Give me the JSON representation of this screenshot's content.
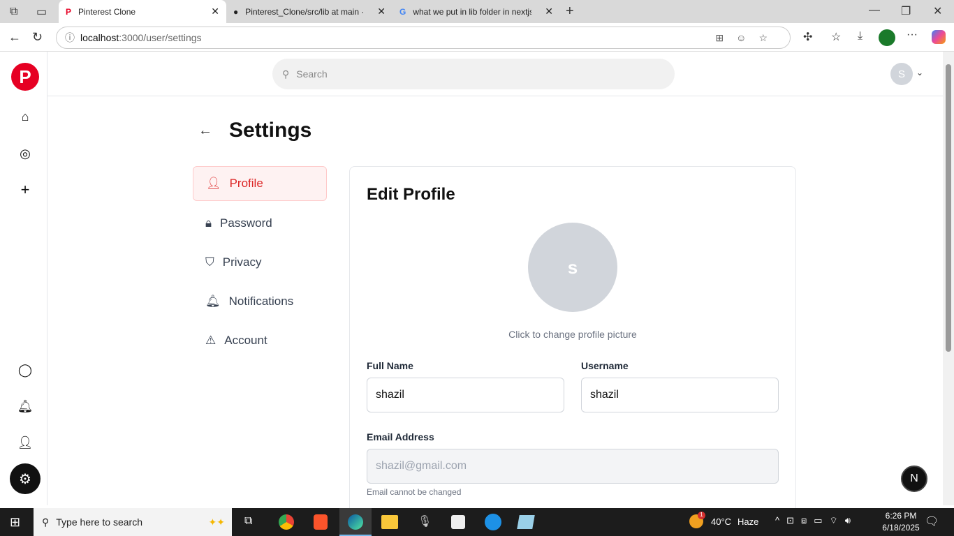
{
  "browser": {
    "tabs": [
      {
        "title": "Pinterest Clone",
        "active": true
      },
      {
        "title": "Pinterest_Clone/src/lib at main · M"
      },
      {
        "title": "what we put in lib folder in nextjs"
      }
    ],
    "url_host": "localhost",
    "url_path": ":3000/user/settings"
  },
  "header": {
    "search_placeholder": "Search",
    "avatar_initial": "S"
  },
  "page": {
    "title": "Settings",
    "nav": [
      {
        "label": "Profile",
        "icon": "user-icon"
      },
      {
        "label": "Password",
        "icon": "lock-icon"
      },
      {
        "label": "Privacy",
        "icon": "shield-icon"
      },
      {
        "label": "Notifications",
        "icon": "bell-icon"
      },
      {
        "label": "Account",
        "icon": "warning-icon"
      }
    ],
    "card": {
      "title": "Edit Profile",
      "avatar_initial": "s",
      "avatar_caption": "Click to change profile picture",
      "full_name_label": "Full Name",
      "full_name_value": "shazil",
      "username_label": "Username",
      "username_value": "shazil",
      "email_label": "Email Address",
      "email_value": "shazil@gmail.com",
      "email_note": "Email cannot be changed"
    }
  },
  "fab": "N",
  "taskbar": {
    "search_placeholder": "Type here to search",
    "weather": "40°C",
    "weather_desc": "Haze",
    "weather_badge": "1",
    "time": "6:26 PM",
    "date": "6/18/2025"
  },
  "colors": {
    "brand": "#e60023",
    "active": "#dc2626"
  }
}
